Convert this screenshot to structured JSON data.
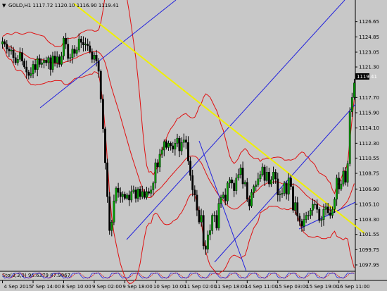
{
  "chart_data": {
    "type": "candlestick",
    "symbol_header": "GOLD,H1  1117.72 1120.10 1116.90 1119.41",
    "current_price": "1119.41",
    "ylim": [
      1097.2,
      1129.2
    ],
    "y_ticks": [
      "1126.65",
      "1124.85",
      "1123.05",
      "1121.30",
      "1117.70",
      "1115.90",
      "1114.10",
      "1112.30",
      "1110.55",
      "1108.75",
      "1106.90",
      "1105.10",
      "1103.30",
      "1101.55",
      "1099.75",
      "1097.95"
    ],
    "x_labels": [
      "4 Sep 2015",
      "7 Sep 14:00",
      "8 Sep 10:00",
      "9 Sep 02:00",
      "9 Sep 18:00",
      "10 Sep 10:00",
      "11 Sep 02:00",
      "11 Sep 18:00",
      "14 Sep 11:00",
      "15 Sep 03:00",
      "15 Sep 19:00",
      "16 Sep 11:00"
    ],
    "x_tick_indices": [
      0,
      14,
      28,
      42,
      56,
      70,
      84,
      98,
      112,
      126,
      140,
      154
    ],
    "n_bars": 162,
    "close": [
      1124.3,
      1124.0,
      1123.4,
      1123.2,
      1123.3,
      1122.4,
      1121.8,
      1122.2,
      1123.0,
      1122.0,
      1121.3,
      1120.7,
      1120.3,
      1120.5,
      1121.6,
      1121.0,
      1122.3,
      1121.6,
      1121.8,
      1122.1,
      1121.8,
      1122.4,
      1121.0,
      1122.6,
      1121.8,
      1122.5,
      1121.6,
      1122.6,
      1124.7,
      1124.0,
      1122.3,
      1122.4,
      1123.4,
      1122.9,
      1123.3,
      1124.6,
      1124.2,
      1123.9,
      1124.0,
      1123.8,
      1123.1,
      1122.2,
      1122.7,
      1122.0,
      1120.8,
      1117.5,
      1114.0,
      1110.0,
      1106.0,
      1102.0,
      1103.0,
      1105.5,
      1107.0,
      1106.5,
      1106.0,
      1106.3,
      1105.8,
      1106.2,
      1105.6,
      1106.6,
      1106.8,
      1105.8,
      1106.9,
      1106.0,
      1106.6,
      1105.9,
      1106.6,
      1106.4,
      1106.8,
      1107.6,
      1110.0,
      1109.5,
      1111.0,
      1111.5,
      1112.5,
      1111.8,
      1112.3,
      1112.0,
      1111.6,
      1112.3,
      1112.9,
      1111.4,
      1112.4,
      1112.7,
      1112.4,
      1110.2,
      1108.5,
      1106.8,
      1106.2,
      1104.4,
      1103.0,
      1103.8,
      1100.2,
      1099.8,
      1101.5,
      1102.0,
      1103.8,
      1103.8,
      1102.3,
      1105.2,
      1105.9,
      1106.2,
      1105.5,
      1107.6,
      1108.0,
      1107.6,
      1106.7,
      1108.2,
      1108.6,
      1109.4,
      1107.5,
      1107.7,
      1105.7,
      1104.9,
      1106.5,
      1107.2,
      1107.4,
      1108.1,
      1108.6,
      1109.5,
      1107.9,
      1108.9,
      1107.5,
      1108.0,
      1108.9,
      1108.1,
      1106.2,
      1106.3,
      1106.4,
      1107.6,
      1106.3,
      1108.2,
      1107.2,
      1104.4,
      1105.3,
      1103.7,
      1103.1,
      1102.5,
      1103.3,
      1103.8,
      1103.8,
      1104.4,
      1105.1,
      1105.1,
      1104.5,
      1103.2,
      1103.3,
      1104.5,
      1104.8,
      1104.1,
      1103.8,
      1104.5,
      1105.7,
      1108.2,
      1106.9,
      1107.5,
      1109.0,
      1107.7,
      1109.9,
      1116.0,
      1117.7,
      1119.41
    ]
  }
}
